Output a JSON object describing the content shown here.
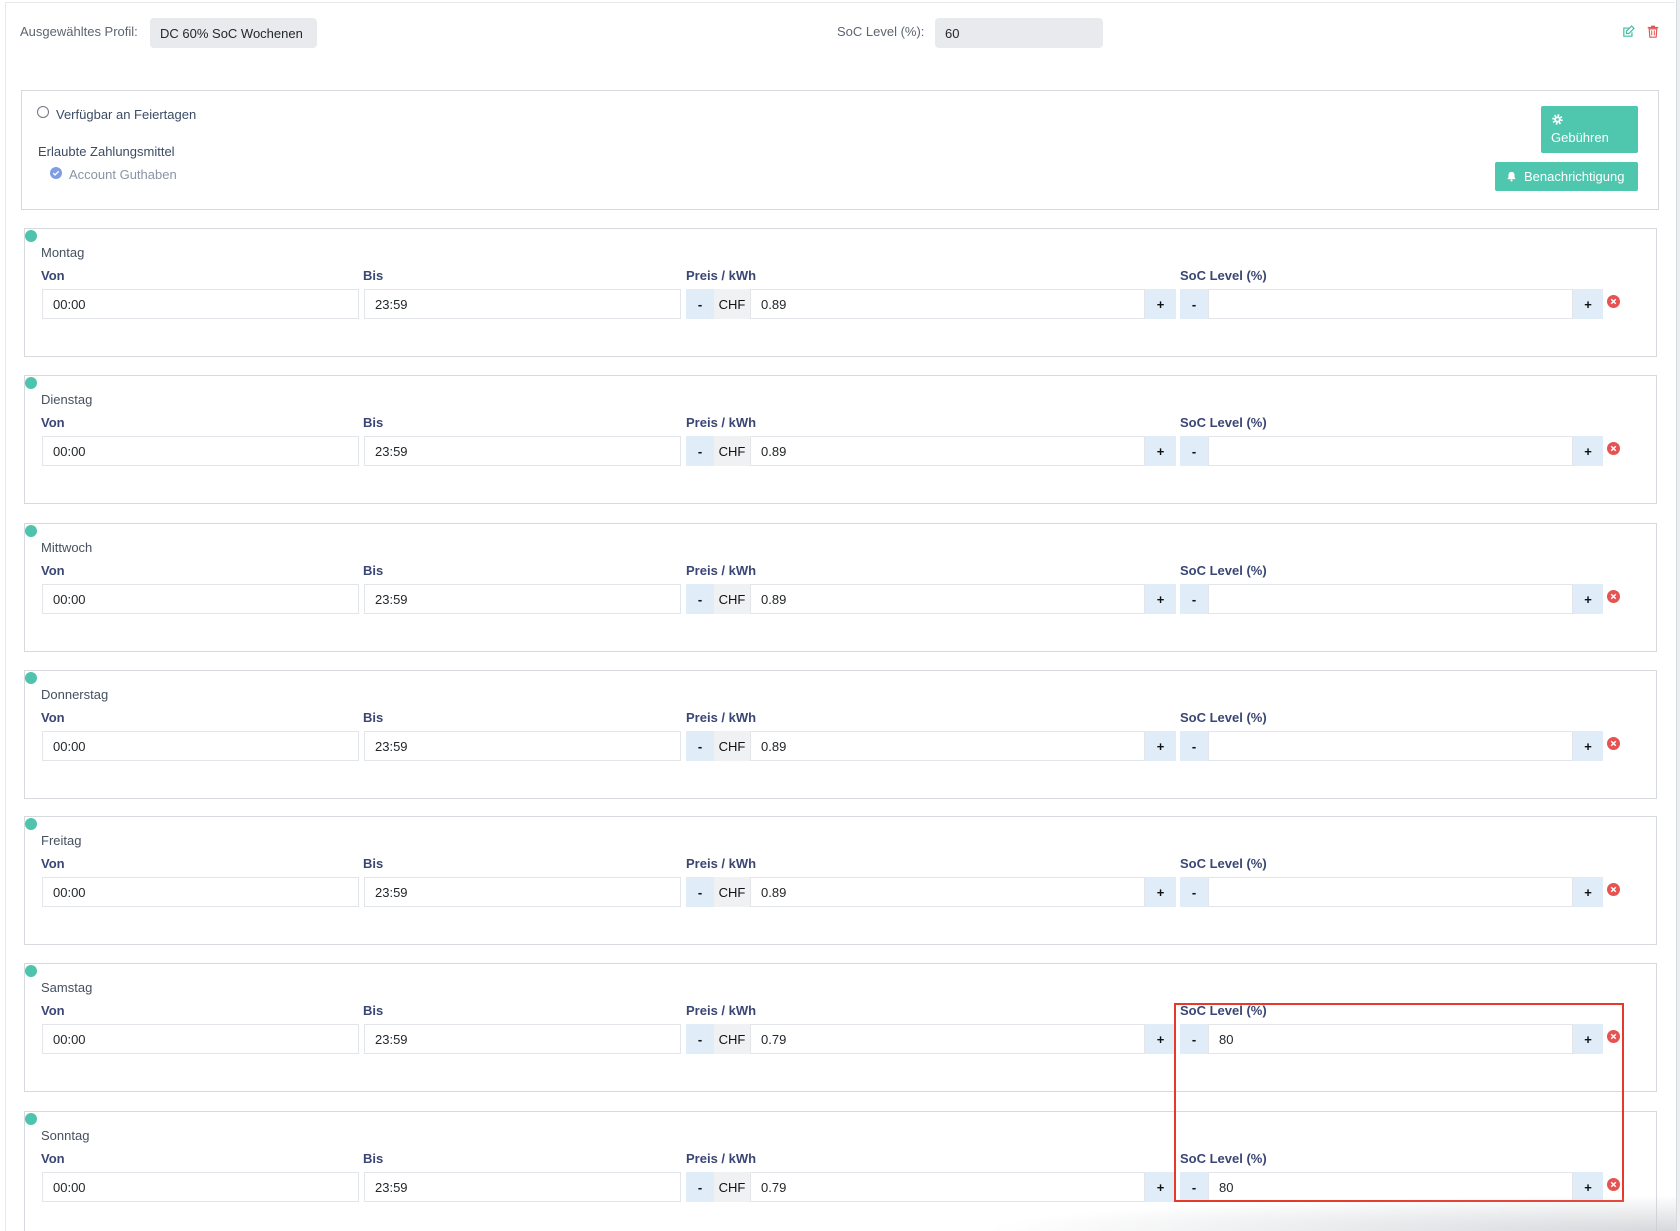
{
  "header": {
    "profile_label": "Ausgewähltes Profil:",
    "profile_value": "DC 60% SoC Wochenen",
    "soc_label": "SoC Level (%):",
    "soc_value": "60"
  },
  "options": {
    "holiday_label": "Verfügbar an Feiertagen",
    "holiday_checked": false,
    "payment_heading": "Erlaubte Zahlungsmittel",
    "payment_methods": [
      {
        "label": "Account Guthaben",
        "checked": true
      }
    ],
    "fees_button": "Gebühren",
    "notify_button": "Benachrichtigung"
  },
  "labels": {
    "from": "Von",
    "to": "Bis",
    "price": "Preis / kWh",
    "soc": "SoC Level (%)",
    "currency": "CHF"
  },
  "stepper": {
    "minus": "-",
    "plus": "+"
  },
  "days": [
    {
      "name": "Montag",
      "from": "00:00",
      "to": "23:59",
      "price": "0.89",
      "soc": ""
    },
    {
      "name": "Dienstag",
      "from": "00:00",
      "to": "23:59",
      "price": "0.89",
      "soc": ""
    },
    {
      "name": "Mittwoch",
      "from": "00:00",
      "to": "23:59",
      "price": "0.89",
      "soc": ""
    },
    {
      "name": "Donnerstag",
      "from": "00:00",
      "to": "23:59",
      "price": "0.89",
      "soc": ""
    },
    {
      "name": "Freitag",
      "from": "00:00",
      "to": "23:59",
      "price": "0.89",
      "soc": ""
    },
    {
      "name": "Samstag",
      "from": "00:00",
      "to": "23:59",
      "price": "0.79",
      "soc": "80"
    },
    {
      "name": "Sonntag",
      "from": "00:00",
      "to": "23:59",
      "price": "0.79",
      "soc": "80"
    }
  ],
  "icons": {
    "edit": "edit-icon",
    "delete": "trash-icon",
    "fees": "gear-icon",
    "notify": "bell-icon",
    "payment_checked": "check-circle-icon",
    "remove_row": "times-circle-icon",
    "day_marker": "dot-icon"
  },
  "colors": {
    "accent": "#4fc6ae",
    "danger": "#e55353",
    "highlight": "#e5392b",
    "label": "#3a4674",
    "stepper": "#e0ecf8",
    "input_readonly": "#e8eaed"
  }
}
